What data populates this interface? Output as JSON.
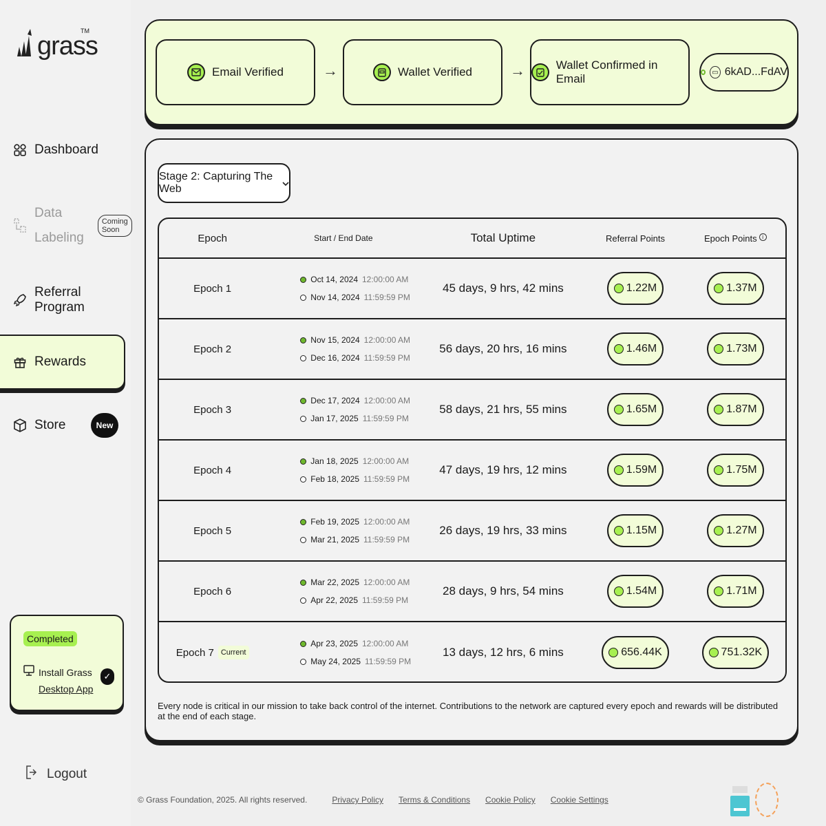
{
  "brand": {
    "name": "grass",
    "tm": "TM"
  },
  "sidebar": {
    "items": [
      {
        "label": "Dashboard",
        "icon": "grid-icon"
      },
      {
        "label_line1": "Data",
        "label_line2": "Labeling",
        "badge": "Coming Soon",
        "icon": "labeling-icon"
      },
      {
        "label": "Referral Program",
        "icon": "rocket-icon"
      },
      {
        "label": "Rewards",
        "icon": "gift-icon",
        "active": true
      },
      {
        "label": "Store",
        "badge": "New",
        "icon": "box-icon"
      }
    ],
    "completed": {
      "pill": "Completed",
      "line1": "Install Grass",
      "line2": "Desktop App",
      "check": "✓"
    },
    "logout": "Logout"
  },
  "verify": {
    "steps": [
      {
        "label": "Email Verified",
        "icon": "mail-icon"
      },
      {
        "label": "Wallet Verified",
        "icon": "wallet-icon"
      },
      {
        "label": "Wallet Confirmed in Email",
        "icon": "wallet-confirm-icon"
      }
    ],
    "wallet_address": "6kAD...FdAV"
  },
  "stage": {
    "selected": "Stage 2: Capturing The Web"
  },
  "table": {
    "headers": {
      "epoch": "Epoch",
      "date": "Start / End Date",
      "uptime": "Total Uptime",
      "referral": "Referral Points",
      "points": "Epoch Points"
    },
    "rows": [
      {
        "epoch": "Epoch 1",
        "start_date": "Oct 14, 2024",
        "start_time": "12:00:00 AM",
        "end_date": "Nov 14, 2024",
        "end_time": "11:59:59 PM",
        "uptime": "45 days, 9 hrs, 42 mins",
        "referral": "1.22M",
        "points": "1.37M"
      },
      {
        "epoch": "Epoch 2",
        "start_date": "Nov 15, 2024",
        "start_time": "12:00:00 AM",
        "end_date": "Dec 16, 2024",
        "end_time": "11:59:59 PM",
        "uptime": "56 days, 20 hrs, 16 mins",
        "referral": "1.46M",
        "points": "1.73M"
      },
      {
        "epoch": "Epoch 3",
        "start_date": "Dec 17, 2024",
        "start_time": "12:00:00 AM",
        "end_date": "Jan 17, 2025",
        "end_time": "11:59:59 PM",
        "uptime": "58 days, 21 hrs, 55 mins",
        "referral": "1.65M",
        "points": "1.87M"
      },
      {
        "epoch": "Epoch 4",
        "start_date": "Jan 18, 2025",
        "start_time": "12:00:00 AM",
        "end_date": "Feb 18, 2025",
        "end_time": "11:59:59 PM",
        "uptime": "47 days, 19 hrs, 12 mins",
        "referral": "1.59M",
        "points": "1.75M"
      },
      {
        "epoch": "Epoch 5",
        "start_date": "Feb 19, 2025",
        "start_time": "12:00:00 AM",
        "end_date": "Mar 21, 2025",
        "end_time": "11:59:59 PM",
        "uptime": "26 days, 19 hrs, 33 mins",
        "referral": "1.15M",
        "points": "1.27M"
      },
      {
        "epoch": "Epoch 6",
        "start_date": "Mar 22, 2025",
        "start_time": "12:00:00 AM",
        "end_date": "Apr 22, 2025",
        "end_time": "11:59:59 PM",
        "uptime": "28 days, 9 hrs, 54 mins",
        "referral": "1.54M",
        "points": "1.71M"
      },
      {
        "epoch": "Epoch 7",
        "tag": "Current",
        "start_date": "Apr 23, 2025",
        "start_time": "12:00:00 AM",
        "end_date": "May 24, 2025",
        "end_time": "11:59:59 PM",
        "uptime": "13 days, 12 hrs, 6 mins",
        "referral": "656.44K",
        "points": "751.32K"
      }
    ]
  },
  "footnote": "Every node is critical in our mission to take back control of the internet. Contributions to the network are captured every epoch and rewards will be distributed at the end of each stage.",
  "footer": {
    "copyright": "© Grass Foundation, 2025. All rights reserved.",
    "links": [
      "Privacy Policy",
      "Terms & Conditions",
      "Cookie Policy",
      "Cookie Settings"
    ]
  },
  "colors": {
    "accent": "#a7f050",
    "panel_tint": "#f2fcd8",
    "border": "#1d1d1d"
  }
}
